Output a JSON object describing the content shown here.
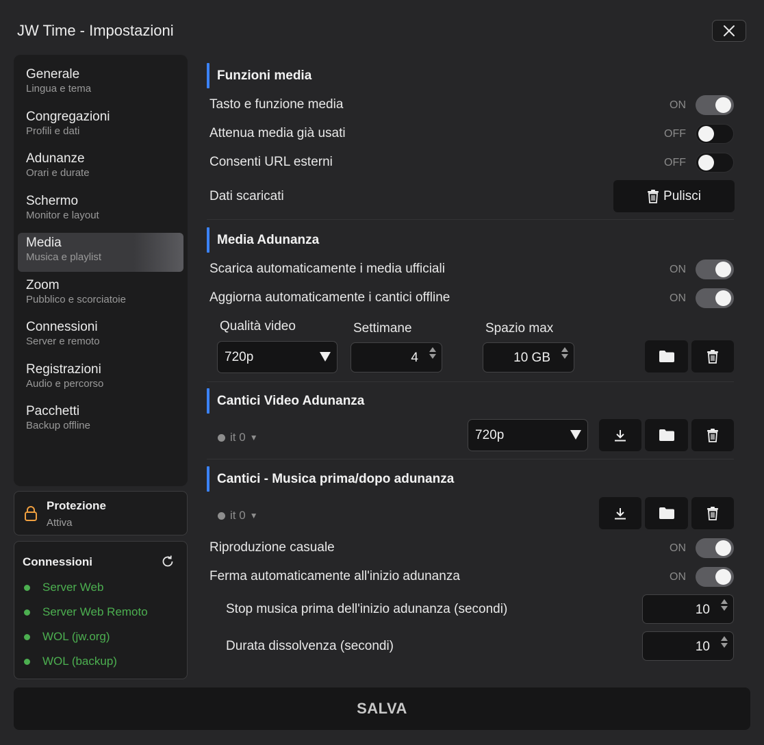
{
  "window": {
    "title": "JW Time - Impostazioni"
  },
  "nav": [
    {
      "title": "Generale",
      "subtitle": "Lingua e tema"
    },
    {
      "title": "Congregazioni",
      "subtitle": "Profili e dati"
    },
    {
      "title": "Adunanze",
      "subtitle": "Orari e durate"
    },
    {
      "title": "Schermo",
      "subtitle": "Monitor e layout"
    },
    {
      "title": "Media",
      "subtitle": "Musica e playlist"
    },
    {
      "title": "Zoom",
      "subtitle": "Pubblico e scorciatoie"
    },
    {
      "title": "Connessioni",
      "subtitle": "Server e remoto"
    },
    {
      "title": "Registrazioni",
      "subtitle": "Audio e percorso"
    },
    {
      "title": "Pacchetti",
      "subtitle": "Backup offline"
    }
  ],
  "active_nav": "Media",
  "protection": {
    "title": "Protezione",
    "status": "Attiva"
  },
  "connections": {
    "title": "Connessioni",
    "items": [
      "Server Web",
      "Server Web Remoto",
      "WOL (jw.org)",
      "WOL (backup)"
    ],
    "status_color": "#4caf50"
  },
  "sections": {
    "media_functions": {
      "title": "Funzioni media",
      "rows": [
        {
          "label": "Tasto e funzione media",
          "state": "ON"
        },
        {
          "label": "Attenua media già usati",
          "state": "OFF"
        },
        {
          "label": "Consenti URL esterni",
          "state": "OFF"
        }
      ],
      "downloaded": {
        "label": "Dati scaricati",
        "button": "Pulisci"
      }
    },
    "meeting_media": {
      "title": "Media Adunanza",
      "rows": [
        {
          "label": "Scarica automaticamente i media ufficiali",
          "state": "ON"
        },
        {
          "label": "Aggiorna automaticamente i cantici offline",
          "state": "ON"
        }
      ],
      "video_quality": {
        "label": "Qualità video",
        "value": "720p"
      },
      "weeks": {
        "label": "Settimane",
        "value": "4"
      },
      "max_space": {
        "label": "Spazio max",
        "value": "10 GB"
      }
    },
    "video_songs": {
      "title": "Cantici Video Adunanza",
      "lang": "it 0",
      "quality": "720p"
    },
    "music_songs": {
      "title": "Cantici - Musica prima/dopo adunanza",
      "lang": "it 0",
      "rows": [
        {
          "label": "Riproduzione casuale",
          "state": "ON"
        },
        {
          "label": "Ferma automaticamente all'inizio adunanza",
          "state": "ON"
        }
      ],
      "stop_before": {
        "label": "Stop musica prima dell'inizio adunanza (secondi)",
        "value": "10"
      },
      "fade": {
        "label": "Durata dissolvenza (secondi)",
        "value": "10"
      }
    }
  },
  "save_label": "SALVA",
  "accent_color": "#3b82f6",
  "lock_color": "#f0a040"
}
